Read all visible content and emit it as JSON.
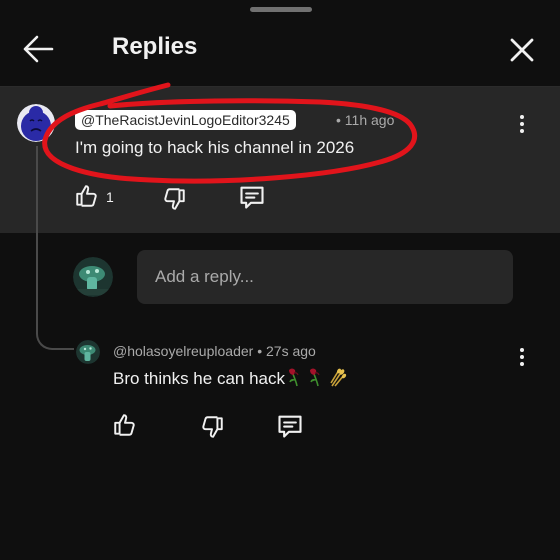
{
  "header": {
    "title": "Replies",
    "back_icon": "arrow-left-icon",
    "close_icon": "close-icon"
  },
  "parent_comment": {
    "author": "@TheRacistJevinLogoEditor3245",
    "time": "• 11h ago",
    "text": "I'm going to hack his channel in 2026",
    "like_count": "1",
    "avatar_icon": "sad-face-avatar-icon",
    "annotation_color": "#e1141b"
  },
  "reply_box": {
    "placeholder": "Add a reply..."
  },
  "reply": {
    "author": "@holasoyelreuploader",
    "time": "• 27s ago",
    "text": "Bro thinks he can hack",
    "emojis": [
      "wilted-rose-emoji",
      "wilted-rose-emoji",
      "sheaf-of-rice-emoji"
    ]
  },
  "colors": {
    "background": "#0f0f0f",
    "highlight_background": "#272727",
    "text_primary": "#f1f1f1",
    "text_secondary": "#aaaaaa",
    "scribble_red": "#e1141b"
  }
}
